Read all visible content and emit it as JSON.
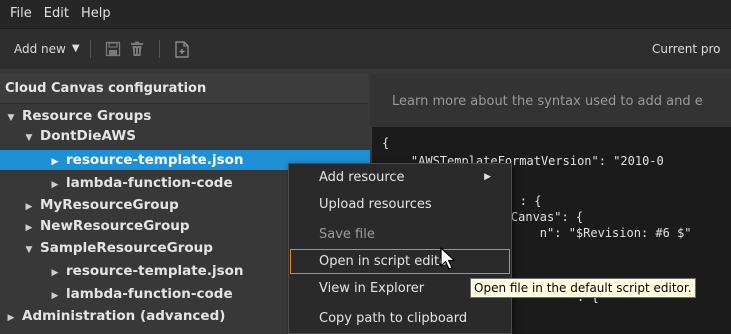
{
  "menubar": {
    "items": [
      "File",
      "Edit",
      "Help"
    ]
  },
  "toolbar": {
    "add_new_label": "Add new",
    "current_label": "Current pro"
  },
  "tree": {
    "header": "Cloud Canvas configuration",
    "rows": [
      {
        "label": "Resource Groups",
        "expanded": true
      },
      {
        "label": "DontDieAWS",
        "expanded": true
      },
      {
        "label": "resource-template.json",
        "expanded": false,
        "selected": true
      },
      {
        "label": "lambda-function-code",
        "expanded": false
      },
      {
        "label": "MyResourceGroup",
        "expanded": false
      },
      {
        "label": "NewResourceGroup",
        "expanded": false
      },
      {
        "label": "SampleResourceGroup",
        "expanded": true
      },
      {
        "label": "resource-template.json",
        "expanded": false
      },
      {
        "label": "lambda-function-code",
        "expanded": false
      },
      {
        "label": "Administration (advanced)",
        "expanded": false
      }
    ]
  },
  "editor": {
    "learn_more": "Learn more about the syntax used to add and e",
    "code_lines": [
      "{",
      "    \"AWSTemplateFormatVersion\": \"2010-0",
      "        : {",
      "    Canvas\": {",
      "        n\": \"$Revision: #6 $\"",
      "",
      "",
      "        \": {"
    ]
  },
  "context_menu": {
    "items": [
      {
        "label": "Add resource",
        "submenu": true,
        "enabled": true
      },
      {
        "label": "Upload resources",
        "enabled": true
      },
      {
        "label": "Save file",
        "enabled": false
      },
      {
        "label": "Open in script editor",
        "enabled": true,
        "highlighted": true
      },
      {
        "label": "View in Explorer",
        "enabled": true
      },
      {
        "label": "Copy path to clipboard",
        "enabled": true
      }
    ]
  },
  "tooltip": {
    "text": "Open file in the default script editor."
  },
  "colors": {
    "selection": "#1e90d8",
    "highlight_border": "#e0862a",
    "tooltip_bg": "#ffffe1"
  }
}
